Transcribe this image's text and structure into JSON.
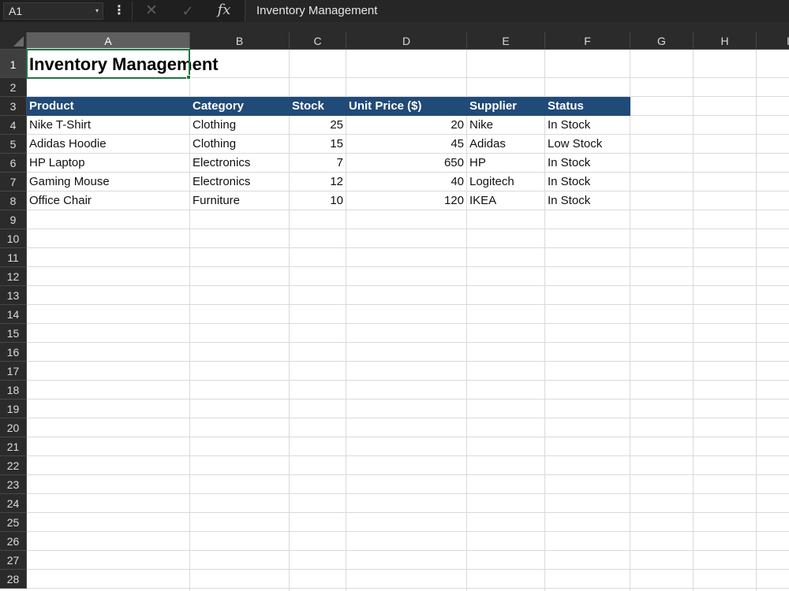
{
  "formula_bar": {
    "name_box": "A1",
    "name_box_dropdown_icon": "▾",
    "more_icon": "⋮",
    "cancel_icon": "✕",
    "enter_icon": "✓",
    "fx_icon": "fx",
    "formula": "Inventory Management"
  },
  "columns": [
    "A",
    "B",
    "C",
    "D",
    "E",
    "F",
    "G",
    "H",
    "I"
  ],
  "selected_column": "A",
  "rows": [
    "1",
    "2",
    "3",
    "4",
    "5",
    "6",
    "7",
    "8",
    "9",
    "10",
    "11",
    "12",
    "13",
    "14",
    "15",
    "16",
    "17",
    "18",
    "19",
    "20",
    "21",
    "22",
    "23",
    "24",
    "25",
    "26",
    "27",
    "28"
  ],
  "selected_row": "1",
  "sheet": {
    "title": "Inventory Management",
    "header_fill_color": "#204a78",
    "active_border_color": "#217346",
    "headers": [
      "Product",
      "Category",
      "Stock",
      "Unit Price ($)",
      "Supplier",
      "Status"
    ],
    "data": [
      {
        "product": "Nike T-Shirt",
        "category": "Clothing",
        "stock": "25",
        "unit_price": "20",
        "supplier": "Nike",
        "status": "In Stock"
      },
      {
        "product": "Adidas Hoodie",
        "category": "Clothing",
        "stock": "15",
        "unit_price": "45",
        "supplier": "Adidas",
        "status": "Low Stock"
      },
      {
        "product": "HP Laptop",
        "category": "Electronics",
        "stock": "7",
        "unit_price": "650",
        "supplier": "HP",
        "status": "In Stock"
      },
      {
        "product": "Gaming Mouse",
        "category": "Electronics",
        "stock": "12",
        "unit_price": "40",
        "supplier": "Logitech",
        "status": "In Stock"
      },
      {
        "product": "Office Chair",
        "category": "Furniture",
        "stock": "10",
        "unit_price": "120",
        "supplier": "IKEA",
        "status": "In Stock"
      }
    ]
  }
}
